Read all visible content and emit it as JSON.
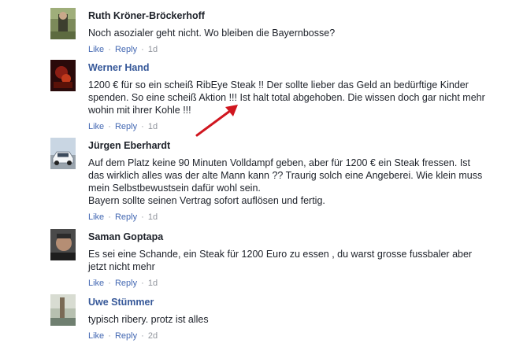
{
  "comments": [
    {
      "author": "Ruth Kröner-Bröckerhoff",
      "author_style": "dark",
      "lines": [
        "Noch asozialer geht nicht. Wo bleiben die Bayernbosse?"
      ],
      "like": "Like",
      "reply": "Reply",
      "sep": "·",
      "time": "1d"
    },
    {
      "author": "Werner Hand",
      "author_style": "blue",
      "lines": [
        "1200 € für so ein scheiß RibEye Steak !! Der sollte lieber das Geld an bedürftige Kinder",
        "spenden. So eine scheiß Aktion !!! Ist halt total abgehoben. Die wissen doch gar nicht mehr",
        "wohin mit ihrer Kohle !!!"
      ],
      "like": "Like",
      "reply": "Reply",
      "sep": "·",
      "time": "1d"
    },
    {
      "author": "Jürgen Eberhardt",
      "author_style": "dark",
      "lines": [
        "Auf dem Platz keine 90 Minuten Volldampf geben, aber für 1200 € ein Steak fressen. Ist",
        "das wirklich alles was der alte Mann kann ?? Traurig solch eine Angeberei. Wie klein muss",
        "mein Selbstbewustsein dafür wohl sein.",
        "Bayern sollte seinen Vertrag sofort auflösen und fertig."
      ],
      "like": "Like",
      "reply": "Reply",
      "sep": "·",
      "time": "1d"
    },
    {
      "author": "Saman Goptapa",
      "author_style": "dark",
      "lines": [
        "Es sei eine Schande, ein Steak für 1200 Euro zu essen , du warst grosse fussbaler aber",
        "jetzt nicht mehr"
      ],
      "like": "Like",
      "reply": "Reply",
      "sep": "·",
      "time": "1d"
    },
    {
      "author": "Uwe Stümmer",
      "author_style": "blue",
      "lines": [
        "typisch ribery. protz ist alles"
      ],
      "like": "Like",
      "reply": "Reply",
      "sep": "·",
      "time": "2d"
    }
  ],
  "colors": {
    "link": "#4267b2",
    "name_blue": "#365899",
    "meta_gray": "#90949c",
    "arrow_red": "#d0161f"
  }
}
